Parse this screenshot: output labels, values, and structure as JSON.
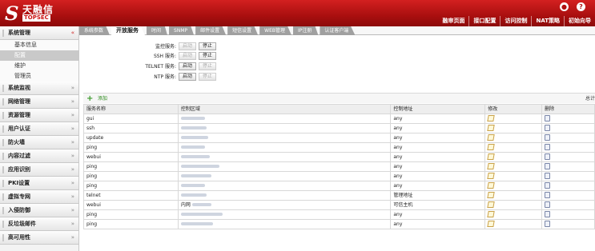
{
  "header": {
    "logo_mark": "S",
    "logo_cn": "天融信",
    "logo_en": "TOPSEC",
    "icons": [
      "lock-icon",
      "help-icon"
    ],
    "nav": [
      "融审页面",
      "接口配置",
      "访问控制",
      "NAT策略",
      "初始向导"
    ]
  },
  "sidebar": {
    "active": {
      "label": "系统管理",
      "chevron": "«",
      "items": [
        {
          "label": "基本信息",
          "selected": false
        },
        {
          "label": "配置",
          "selected": true
        },
        {
          "label": "维护",
          "selected": false
        },
        {
          "label": "管理员",
          "selected": false
        }
      ]
    },
    "sections": [
      {
        "label": "系统监视",
        "chevron": "»"
      },
      {
        "label": "网络管理",
        "chevron": "»"
      },
      {
        "label": "资源管理",
        "chevron": "»"
      },
      {
        "label": "用户认证",
        "chevron": "»"
      },
      {
        "label": "防火墙",
        "chevron": "»"
      },
      {
        "label": "内容过滤",
        "chevron": "»"
      },
      {
        "label": "应用识别",
        "chevron": "»"
      },
      {
        "label": "PKI设置",
        "chevron": "»"
      },
      {
        "label": "虚拟专网",
        "chevron": "»"
      },
      {
        "label": "入侵防御",
        "chevron": "»"
      },
      {
        "label": "反垃圾邮件",
        "chevron": "»"
      },
      {
        "label": "高可用性",
        "chevron": "»"
      }
    ]
  },
  "tabs": [
    {
      "label": "系统参数",
      "active": false
    },
    {
      "label": "开放服务",
      "active": true
    },
    {
      "label": "时间",
      "active": false
    },
    {
      "label": "SNMP",
      "active": false
    },
    {
      "label": "邮件设置",
      "active": false
    },
    {
      "label": "短信设置",
      "active": false
    },
    {
      "label": "WEB管理",
      "active": false
    },
    {
      "label": "IP注册",
      "active": false
    },
    {
      "label": "认证客户端",
      "active": false
    }
  ],
  "services": [
    {
      "name": "监控服务:",
      "start_label": "启动",
      "stop_label": "停止",
      "start_enabled": false,
      "stop_enabled": true
    },
    {
      "name": "SSH 服务:",
      "start_label": "启动",
      "stop_label": "停止",
      "start_enabled": false,
      "stop_enabled": true
    },
    {
      "name": "TELNET 服务:",
      "start_label": "启动",
      "stop_label": "停止",
      "start_enabled": true,
      "stop_enabled": false
    },
    {
      "name": "NTP 服务:",
      "start_label": "启动",
      "stop_label": "停止",
      "start_enabled": true,
      "stop_enabled": false
    }
  ],
  "toolbar": {
    "add_label": "添加",
    "total_label": "总计"
  },
  "table": {
    "headers": [
      "服务名称",
      "控制区域",
      "控制地址",
      "修改",
      "删除"
    ],
    "rows": [
      {
        "service": "gui",
        "area": "",
        "area_blur": true,
        "address": "any"
      },
      {
        "service": "ssh",
        "area": "",
        "area_blur": true,
        "address": "any"
      },
      {
        "service": "update",
        "area": "",
        "area_blur": true,
        "address": "any"
      },
      {
        "service": "ping",
        "area": "",
        "area_blur": true,
        "address": "any"
      },
      {
        "service": "webui",
        "area": "",
        "area_blur": true,
        "address": "any"
      },
      {
        "service": "ping",
        "area": "",
        "area_blur": true,
        "address": "any"
      },
      {
        "service": "ping",
        "area": "",
        "area_blur": true,
        "address": "any"
      },
      {
        "service": "ping",
        "area": "",
        "area_blur": true,
        "address": "any"
      },
      {
        "service": "telnet",
        "area": "",
        "area_blur": true,
        "address": "管理地址"
      },
      {
        "service": "webui",
        "area": "内网",
        "area_blur": true,
        "address": "可信主机"
      },
      {
        "service": "ping",
        "area": "",
        "area_blur": true,
        "address": "any"
      },
      {
        "service": "ping",
        "area": "",
        "area_blur": true,
        "address": "any"
      }
    ]
  }
}
